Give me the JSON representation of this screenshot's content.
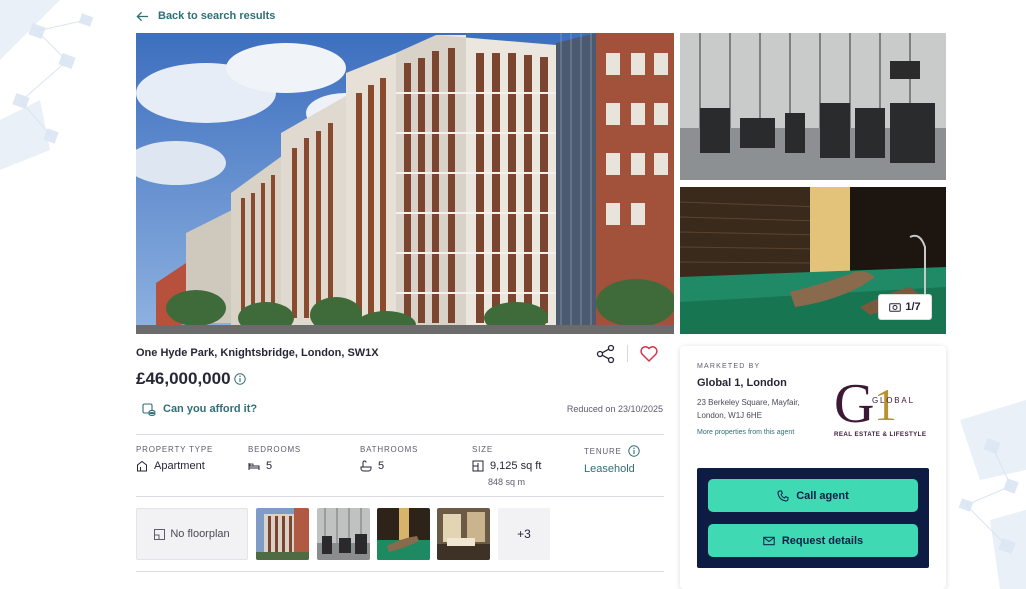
{
  "nav": {
    "back_label": "Back to search results",
    "back_icon": "arrow-left-icon"
  },
  "gallery": {
    "photo_counter": "1/7",
    "photos": [
      "exterior-building",
      "gym",
      "swimming-pool"
    ],
    "thumbnails": [
      "exterior",
      "gym",
      "spa",
      "pool",
      "interior"
    ],
    "more_thumbnails_label": "+3",
    "floorplan_label": "No floorplan"
  },
  "listing": {
    "address": "One Hyde Park, Knightsbridge, London, SW1X",
    "price": "£46,000,000",
    "afford_label": "Can you afford it?",
    "reduced_text": "Reduced on 23/10/2025",
    "favourite_color": "#d6334c"
  },
  "facts": {
    "property_type": {
      "label": "PROPERTY TYPE",
      "value": "Apartment"
    },
    "bedrooms": {
      "label": "BEDROOMS",
      "value": "5"
    },
    "bathrooms": {
      "label": "BATHROOMS",
      "value": "5"
    },
    "size": {
      "label": "SIZE",
      "value": "9,125 sq ft",
      "sub": "848 sq m"
    },
    "tenure": {
      "label": "TENURE",
      "value": "Leasehold"
    }
  },
  "agent": {
    "marketed_by": "MARKETED BY",
    "name": "Global 1, London",
    "address_line1": "23 Berkeley Square, Mayfair,",
    "address_line2": "London, W1J 6HE",
    "more_link": "More properties from this agent",
    "logo_letters": "G1",
    "logo_word": "GLOBAL",
    "logo_tagline": "REAL ESTATE & LIFESTYLE",
    "call_label": "Call agent",
    "request_label": "Request details"
  },
  "colors": {
    "accent_teal": "#2f6f78",
    "cta_green": "#3fdab4",
    "contact_navy": "#0e1c44",
    "logo_purple": "#3c1a35",
    "logo_gold": "#b8922e"
  }
}
